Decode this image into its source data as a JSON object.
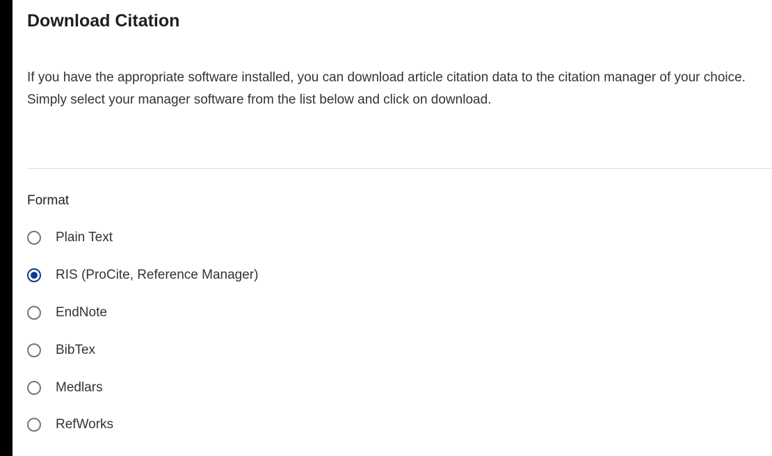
{
  "dialog": {
    "title": "Download Citation",
    "intro": "If you have the appropriate software installed, you can download article citation data to the citation manager of your choice. Simply select your manager software from the list below and click on download."
  },
  "format": {
    "label": "Format",
    "selected": "RIS (ProCite, Reference Manager)",
    "options": [
      {
        "label": "Plain Text",
        "checked": false
      },
      {
        "label": "RIS (ProCite, Reference Manager)",
        "checked": true
      },
      {
        "label": "EndNote",
        "checked": false
      },
      {
        "label": "BibTex",
        "checked": false
      },
      {
        "label": "Medlars",
        "checked": false
      },
      {
        "label": "RefWorks",
        "checked": false
      }
    ]
  },
  "colors": {
    "accent": "#0b3a8c",
    "background": "#ffffff",
    "frame": "#000000"
  }
}
